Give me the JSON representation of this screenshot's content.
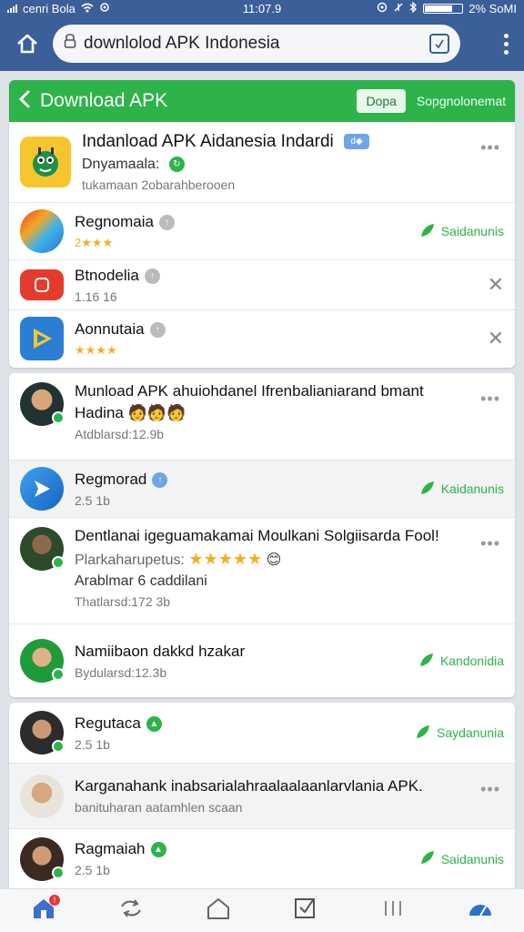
{
  "status_bar": {
    "carrier": "cenri Bola",
    "time": "11:07.9",
    "battery": "2% SoMI"
  },
  "browser": {
    "url": "downlolod APK Indonesia"
  },
  "header": {
    "title": "Download APK",
    "button_label": "Dopa",
    "link_label": "Sopgnolonemat"
  },
  "featured": {
    "title": "Indanload APK Aidanesia Indardi",
    "subtitle": "Dnyamaala:",
    "description": "tukamaan 2obarahberooen"
  },
  "apps": [
    {
      "name": "Regnomaia",
      "meta": "2★★★",
      "action": "Saidanunis"
    },
    {
      "name": "Btnodelia",
      "meta": "1.16 16"
    },
    {
      "name": "Aonnutaia",
      "meta": "★★★★"
    }
  ],
  "section2": [
    {
      "name": "Munload APK ahuiohdanel Ifrenbalianiarand bmant",
      "extra": "Hadina",
      "meta": "Atdblarsd:12.9b"
    },
    {
      "name": "Regmorad",
      "meta": "2.5 1b",
      "action": "Kaidanunis"
    },
    {
      "name": "Dentlanai igeguamakamai Moulkani Solgiisarda Fool!",
      "extra": "Plarkaharupetus:",
      "extra2": "Arablmar 6 caddilani",
      "meta": "Thatlarsd:172 3b"
    },
    {
      "name": "Namiibaon dakkd hzakar",
      "meta": "Bydularsd:12.3b",
      "action": "Kandonidia"
    }
  ],
  "section3": [
    {
      "name": "Regutaca",
      "meta": "2.5 1b",
      "action": "Saydanunia"
    },
    {
      "name": "Karganahank inabsarialahraalaalaanlarvlania APK.",
      "meta": "banituharan aatamhlen scaan"
    },
    {
      "name": "Ragmaiah",
      "meta": "2.5 1b",
      "action": "Saidanunis"
    }
  ],
  "colors": {
    "brand_green": "#2db34a",
    "browser_blue": "#3a5f99",
    "star": "#f2b01e"
  }
}
